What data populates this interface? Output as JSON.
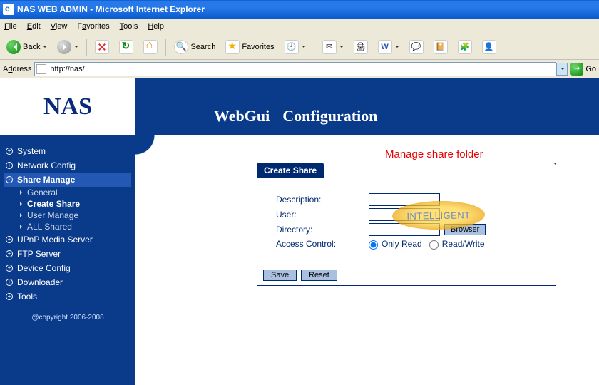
{
  "window": {
    "title": "NAS WEB ADMIN - Microsoft Internet Explorer"
  },
  "menubar": {
    "file": "File",
    "edit": "Edit",
    "view": "View",
    "favorites": "Favorites",
    "tools": "Tools",
    "help": "Help"
  },
  "toolbar": {
    "back": "Back",
    "search": "Search",
    "favorites": "Favorites"
  },
  "addressbar": {
    "label": "Address",
    "url": "http://nas/",
    "go": "Go"
  },
  "brand": {
    "logo": "NAS",
    "title_left": "WebGui",
    "title_right": "Configuration"
  },
  "sidebar": {
    "items": [
      {
        "label": "System",
        "expanded": false
      },
      {
        "label": "Network Config",
        "expanded": false
      },
      {
        "label": "Share Manage",
        "expanded": true,
        "children": [
          {
            "label": "General"
          },
          {
            "label": "Create Share",
            "active": true
          },
          {
            "label": "User Manage"
          },
          {
            "label": "ALL Shared"
          }
        ]
      },
      {
        "label": "UPnP Media Server",
        "expanded": false
      },
      {
        "label": "FTP Server",
        "expanded": false
      },
      {
        "label": "Device Config",
        "expanded": false
      },
      {
        "label": "Downloader",
        "expanded": false
      },
      {
        "label": "Tools",
        "expanded": false
      }
    ],
    "copyright": "@copyright 2006-2008"
  },
  "page": {
    "annotation": "Manage share folder",
    "panel_title": "Create Share",
    "fields": {
      "description": "Description:",
      "user": "User:",
      "directory": "Directory:",
      "access_control": "Access Control:",
      "browser_btn": "Browser",
      "only_read": "Only Read",
      "read_write": "Read/Write"
    },
    "buttons": {
      "save": "Save",
      "reset": "Reset"
    },
    "values": {
      "description": "",
      "user": "",
      "directory": "",
      "access": "only_read"
    }
  },
  "watermark": "INTELLIGENT"
}
